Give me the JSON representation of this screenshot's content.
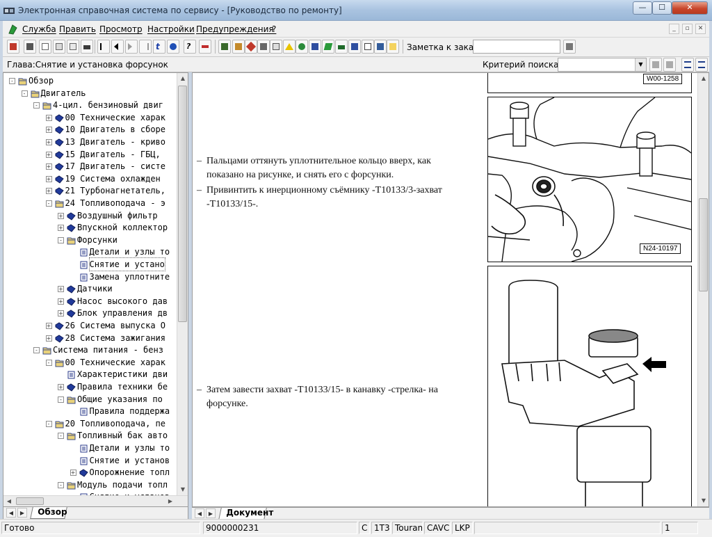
{
  "window": {
    "title": "Электронная справочная система по сервису - [Руководство по ремонту]",
    "controls": {
      "minimize": "—",
      "maximize": "☐",
      "close": "✕"
    }
  },
  "menu": {
    "items": [
      "Служба",
      "Править",
      "Просмотр",
      "Настройки",
      "Предупреждения",
      "?"
    ],
    "mdi_controls": {
      "minimize": "_",
      "restore": "▫",
      "close": "✕"
    }
  },
  "toolbar": {
    "order_note_label": "Заметка к заказу:",
    "order_note_value": ""
  },
  "chapterbar": {
    "chapter": "Глава:Снятие и установка форсунок",
    "search_label": "Критерий  поиска:",
    "search_value": ""
  },
  "tree": {
    "items": [
      {
        "label": "Обзор",
        "level": 0,
        "kind": "folder-open",
        "exp": "-"
      },
      {
        "label": "Двигатель",
        "level": 1,
        "kind": "folder-open",
        "exp": "-"
      },
      {
        "label": "4-цил. бензиновый двиг",
        "level": 2,
        "kind": "folder-open",
        "exp": "-"
      },
      {
        "label": "00 Технические харак",
        "level": 3,
        "kind": "book",
        "exp": "+"
      },
      {
        "label": "10 Двигатель в сборе",
        "level": 3,
        "kind": "book",
        "exp": "+"
      },
      {
        "label": "13 Двигатель - криво",
        "level": 3,
        "kind": "book",
        "exp": "+"
      },
      {
        "label": "15 Двигатель - ГБЦ,",
        "level": 3,
        "kind": "book",
        "exp": "+"
      },
      {
        "label": "17 Двигатель - систе",
        "level": 3,
        "kind": "book",
        "exp": "+"
      },
      {
        "label": "19 Система охлажден",
        "level": 3,
        "kind": "book",
        "exp": "+"
      },
      {
        "label": "21 Турбонагнетатель,",
        "level": 3,
        "kind": "book",
        "exp": "+"
      },
      {
        "label": "24 Топливоподача - э",
        "level": 3,
        "kind": "folder-open",
        "exp": "-"
      },
      {
        "label": "Воздушный фильтр",
        "level": 4,
        "kind": "book",
        "exp": "+"
      },
      {
        "label": "Впускной коллектор",
        "level": 4,
        "kind": "book",
        "exp": "+"
      },
      {
        "label": "Форсунки",
        "level": 4,
        "kind": "folder-open",
        "exp": "-"
      },
      {
        "label": "Детали и узлы то",
        "level": 5,
        "kind": "page",
        "exp": ""
      },
      {
        "label": "Снятие и устано",
        "level": 5,
        "kind": "page",
        "exp": "",
        "selected": true
      },
      {
        "label": "Замена уплотните",
        "level": 5,
        "kind": "page",
        "exp": ""
      },
      {
        "label": "Датчики",
        "level": 4,
        "kind": "book",
        "exp": "+"
      },
      {
        "label": "Насос высокого дав",
        "level": 4,
        "kind": "book",
        "exp": "+"
      },
      {
        "label": "Блок управления дв",
        "level": 4,
        "kind": "book",
        "exp": "+"
      },
      {
        "label": "26 Система выпуска О",
        "level": 3,
        "kind": "book",
        "exp": "+"
      },
      {
        "label": "28 Система зажигания",
        "level": 3,
        "kind": "book",
        "exp": "+"
      },
      {
        "label": "Система питания - бенз",
        "level": 2,
        "kind": "folder-open",
        "exp": "-"
      },
      {
        "label": "00 Технические харак",
        "level": 3,
        "kind": "folder-open",
        "exp": "-"
      },
      {
        "label": "Характеристики дви",
        "level": 4,
        "kind": "page",
        "exp": ""
      },
      {
        "label": "Правила техники бе",
        "level": 4,
        "kind": "book",
        "exp": "+"
      },
      {
        "label": "Общие указания по",
        "level": 4,
        "kind": "folder-open",
        "exp": "-"
      },
      {
        "label": "Правила поддержа",
        "level": 5,
        "kind": "page",
        "exp": ""
      },
      {
        "label": "20 Топливоподача, пе",
        "level": 3,
        "kind": "folder-open",
        "exp": "-"
      },
      {
        "label": "Топливный бак авто",
        "level": 4,
        "kind": "folder-open",
        "exp": "-"
      },
      {
        "label": "Детали и узлы то",
        "level": 5,
        "kind": "page",
        "exp": ""
      },
      {
        "label": "Снятие и установ",
        "level": 5,
        "kind": "page",
        "exp": ""
      },
      {
        "label": "Опорожнение топл",
        "level": 5,
        "kind": "book",
        "exp": "+"
      },
      {
        "label": "Модуль подачи топл",
        "level": 4,
        "kind": "folder-open",
        "exp": "-"
      },
      {
        "label": "Снятие и установ",
        "level": 5,
        "kind": "page",
        "exp": ""
      }
    ]
  },
  "tabs": {
    "left": "Обзор",
    "right": "Документ"
  },
  "document": {
    "steps": [
      "Пальцами оттянуть уплотнительное кольцо вверх, как|показано на рисунке, и снять его с форсунки.",
      "Привинтить к инерционному съёмнику -T10133/3-захват|-T10133/15-.",
      "Затем завести захват -T10133/15- в канавку -стрелка- на|форсунке."
    ],
    "figures": {
      "top_label": "W00-1258",
      "middle_label": "N24-10197"
    }
  },
  "statusbar": {
    "status": "Готово",
    "order_number": "9000000231",
    "cells": [
      "C",
      "1T3",
      "Touran",
      "CAVC",
      "LKP"
    ],
    "page": "1"
  }
}
